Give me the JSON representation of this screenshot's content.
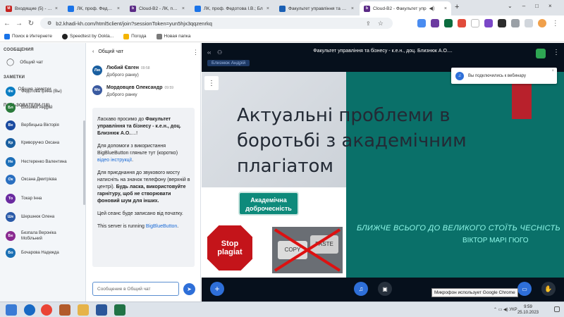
{
  "tabs": [
    {
      "label": "Входящие (5) - tilna7st@gma",
      "color": "#c5221f",
      "active": false
    },
    {
      "label": "ЛК, проф. Федотова І.В.; Бл",
      "color": "#1a73e8",
      "active": false
    },
    {
      "label": "Cloud-B2 - ЛК, проф. Федо",
      "color": "#1a73e8",
      "active": false
    },
    {
      "label": "Факультет управління та бізне",
      "color": "#1a5fb4",
      "active": false
    },
    {
      "label": "Cloud-B2 - Факультет упр",
      "color": "#5b2a86",
      "active": true
    }
  ],
  "address": {
    "url": "b2.khadi-kh.com/html5client/join?sessionToken=yun5hjx3qqzenrkq"
  },
  "bookmarks": [
    "Поиск в Интернете",
    "Speedtest by Ookla...",
    "Погода",
    "Новая папка"
  ],
  "left": {
    "messages_title": "СООБЩЕНИЯ",
    "public_chat": "Общий чат",
    "notes_title": "ЗАМЕТКИ",
    "shared_notes": "Общие заметки",
    "users_title": "ПОЛЬЗОВАТЕЛИ (18)",
    "users": [
      {
        "initials": "Фе",
        "name": "Федотова Ірина (Вы)",
        "color": "#0a7dc2"
      },
      {
        "initials": "Бл",
        "name": "Близнюк Андрій",
        "color": "#2a7a3b"
      },
      {
        "initials": "Ве",
        "name": "Вербицька Вікторія",
        "color": "#1a4aa0"
      },
      {
        "initials": "Кр",
        "name": "Криворучко Оксана",
        "color": "#1a5fa0"
      },
      {
        "initials": "Не",
        "name": "Нестеренко Валентина",
        "color": "#1d6fb8"
      },
      {
        "initials": "Ок",
        "name": "Оксана Дмитрієва",
        "color": "#2a6fc0"
      },
      {
        "initials": "То",
        "name": "Токар Інна",
        "color": "#6a2aa0"
      },
      {
        "initials": "Ше",
        "name": "Шершнюк Олена",
        "color": "#2a5aa8"
      },
      {
        "initials": "Бе",
        "name": "Безпала Вероніка Мобільний",
        "color": "#8a2a90"
      },
      {
        "initials": "Бо",
        "name": "Бочарова Надежда",
        "color": "#1a6fb4"
      }
    ]
  },
  "chat": {
    "title": "Общий чат",
    "messages": [
      {
        "initials": "Лю",
        "name": "Любий Євген",
        "time": "09:58",
        "text": "Доброго ранку)",
        "color": "#1a5fa0"
      },
      {
        "initials": "Мо",
        "name": "Мордовцев Олександр",
        "time": "09:59",
        "text": "Доброго ранку",
        "color": "#3a5aa0"
      }
    ],
    "welcome": {
      "p1_a": "Ласкаво просимо до ",
      "p1_b": "Факультет управління та бізнесу - к.е.н., доц. Близнюк А.О.",
      "p1_c": "....!",
      "p2_a": "Для допомоги з використання BigBlueButton гляньте тут (коротко) ",
      "p2_link": "відео інструкції",
      "p2_c": ".",
      "p3_a": "Для приєднання до звукового мосту натисніть на значок телефону (верхній в центрі). ",
      "p3_b": "Будь ласка, використовуйте гарнітуру, щоб не створювати фоновий шум для інших.",
      "p4": "Цей сеанс буде записано від початку.",
      "p5_a": "This server is running ",
      "p5_link": "BigBlueButton",
      "p5_c": "."
    },
    "input_placeholder": "Сообщение в Общий чат"
  },
  "presentation": {
    "title": "Факультет управління та бізнесу - к.е.н., доц. Близнюк А.О....",
    "presenter_tag": "Близнюк Андрій",
    "notice": "Вы подключились к вебинару",
    "slide_title": "Актуальні проблеми в боротьбі з академічним плагіатом",
    "badge": "Академічна доброчесність",
    "stop_sign": "Stop plagiat",
    "copy_word": "COPY",
    "paste_word": "PASTE",
    "tagline": "БЛИЖЧЕ ВСЬОГО ДО ВЕЛИКОГО СТОЇТЬ ЧЕСНІСТЬ",
    "author": "ВІКТОР МАРІ ГЮГО",
    "tooltip": "Микрофон использует Google Chrome"
  },
  "taskbar": {
    "time": "9:59",
    "date": "25.10.2023",
    "lang": "УКР"
  }
}
